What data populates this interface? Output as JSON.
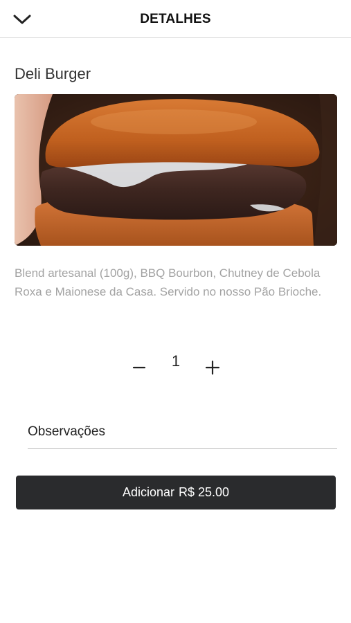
{
  "header": {
    "title": "DETALHES",
    "back_icon": "chevron-down-icon"
  },
  "product": {
    "name": "Deli Burger",
    "image_alt": "burger-photo",
    "description": "Blend artesanal (100g), BBQ Bourbon, Chutney de Cebola Roxa e Maionese da Casa. Servido no nosso Pão Brioche."
  },
  "quantity": {
    "minus_label": "−",
    "value": "1",
    "plus_label": "+"
  },
  "notes": {
    "placeholder": "Observações",
    "value": ""
  },
  "add_button": {
    "label": "Adicionar",
    "price": "R$ 25.00"
  },
  "colors": {
    "button_bg": "#2a2b2d",
    "description_text": "#a3a3a3",
    "divider": "#dcdcdc"
  }
}
